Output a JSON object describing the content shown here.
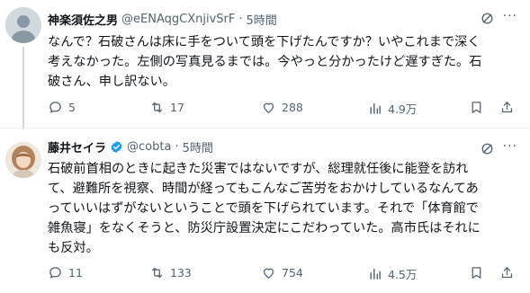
{
  "tweets": [
    {
      "name": "神楽須佐之男",
      "handle": "@eENAqgCXnjivSrF",
      "sep": "·",
      "time": "5時間",
      "more": "···",
      "text": "なんで？石破さんは床に手をついて頭を下げたんですか？いやこれまで深く\n考えなかった。左側の写真見るまでは。今やっと分かったけど遅すぎた。石\n破さん、申し訳ない。",
      "replies": "5",
      "reposts": "17",
      "likes": "288",
      "views": "4.9万"
    },
    {
      "name": "藤井セイラ",
      "handle": "@cobta",
      "sep": "·",
      "time": "5時間",
      "more": "···",
      "text": "石破前首相のときに起きた災害ではないですが、総理就任後に能登を訪れ\nて、避難所を視察、時間が経ってもこんなご苦労をおかけしているなんてあ\nっていいはずがないということで頭を下げられています。それで「体育館で\n雑魚寝」をなくそうと、防災庁設置決定にこだわっていた。高市氏はそれに\nも反対。",
      "replies": "11",
      "reposts": "133",
      "likes": "754",
      "views": "4.5万"
    }
  ],
  "colors": {
    "muted": "#536471",
    "verified": "#1d9bf0",
    "divider": "#eff3f4"
  }
}
